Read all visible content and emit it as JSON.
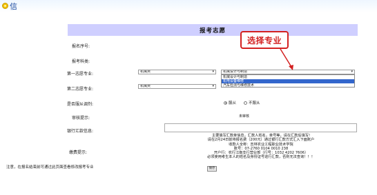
{
  "header": {
    "title": "报考志愿"
  },
  "callout": {
    "text": "选择专业"
  },
  "form": {
    "serial_label": "报名序号:",
    "category_label": "报考科类:",
    "first_choice_label": "第一志愿专业:",
    "second_choice_label": "第二志愿专业:",
    "adjust_label": "是否服从调剂:",
    "review_label": "审核提示:",
    "bank_label": "银行汇款信息:",
    "fee_label": "缴费提示:",
    "first_category_value": "机械类",
    "first_major_value": "机械设计与制造",
    "second_category_value": "机械类",
    "adjust_yes": "服从",
    "adjust_no": "不服从",
    "review_value": "未审核",
    "major_options": [
      "机械设计与制造",
      "机电设备维修",
      "汽车检测与维修技术"
    ]
  },
  "info": {
    "line1": "主要填写汇款单信息，汇款人姓名，单号等，请在汇款后填写!",
    "line2": "请在2月24日前将报名费（200元）通过银行汇款方式汇入下面账户",
    "line3": "收款人全称：吉林农业工程职业技术学院",
    "line4": "账号：07-2760 0104 0010 238",
    "line5": "开户行：农行江南支行营业部（行号：1032 4202 7606）",
    "line6": "必须使用考生本人的姓名及身份证号进行汇款，否则无法查询！！！"
  },
  "save_label": "保存",
  "note": "注意，在报名结束前可通过此页面查看修改报考专业",
  "top": {
    "text": "信"
  }
}
